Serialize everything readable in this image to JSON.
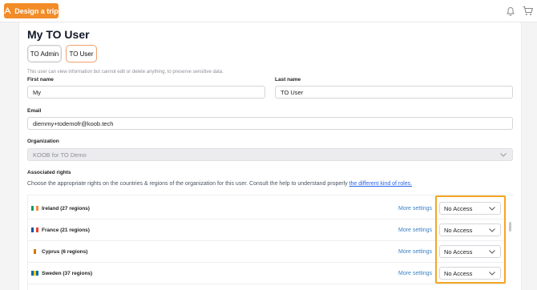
{
  "topbar": {
    "design_label": "Design a trip",
    "colors": {
      "accent": "#f28c28"
    }
  },
  "page": {
    "title": "My TO User",
    "roles": [
      "TO Admin",
      "TO User"
    ],
    "active_role": "TO User",
    "notice": "This user can view information but cannot edit or delete anything, to preserve sensitive data."
  },
  "form": {
    "first_name_label": "First name",
    "first_name_value": "My",
    "last_name_label": "Last name",
    "last_name_value": "TO User",
    "email_label": "Email",
    "email_value": "diemmy+todemofr@koob.tech",
    "organization_label": "Organization",
    "organization_value": "KOOB for TO Demo"
  },
  "rights": {
    "title": "Associated rights",
    "help_text": "Choose the appropriate rights on the countries & regions of the organization for this user. Consult the help to understand properly ",
    "help_link": "the different kind of roles.",
    "more_label": "More settings",
    "items": [
      {
        "country": "Ireland (27 regions)",
        "access": "No Access",
        "flag": [
          "#169b62",
          "#ffffff",
          "#ff883e"
        ]
      },
      {
        "country": "France (21 regions)",
        "access": "No Access",
        "flag": [
          "#0055a4",
          "#ffffff",
          "#ef4135"
        ]
      },
      {
        "country": "Cyprus (6 regions)",
        "access": "No Access",
        "flag": [
          "#ffffff",
          "#d57800",
          "#ffffff"
        ]
      },
      {
        "country": "Sweden (37 regions)",
        "access": "No Access",
        "flag": [
          "#006aa7",
          "#fecc00",
          "#006aa7"
        ]
      }
    ]
  }
}
